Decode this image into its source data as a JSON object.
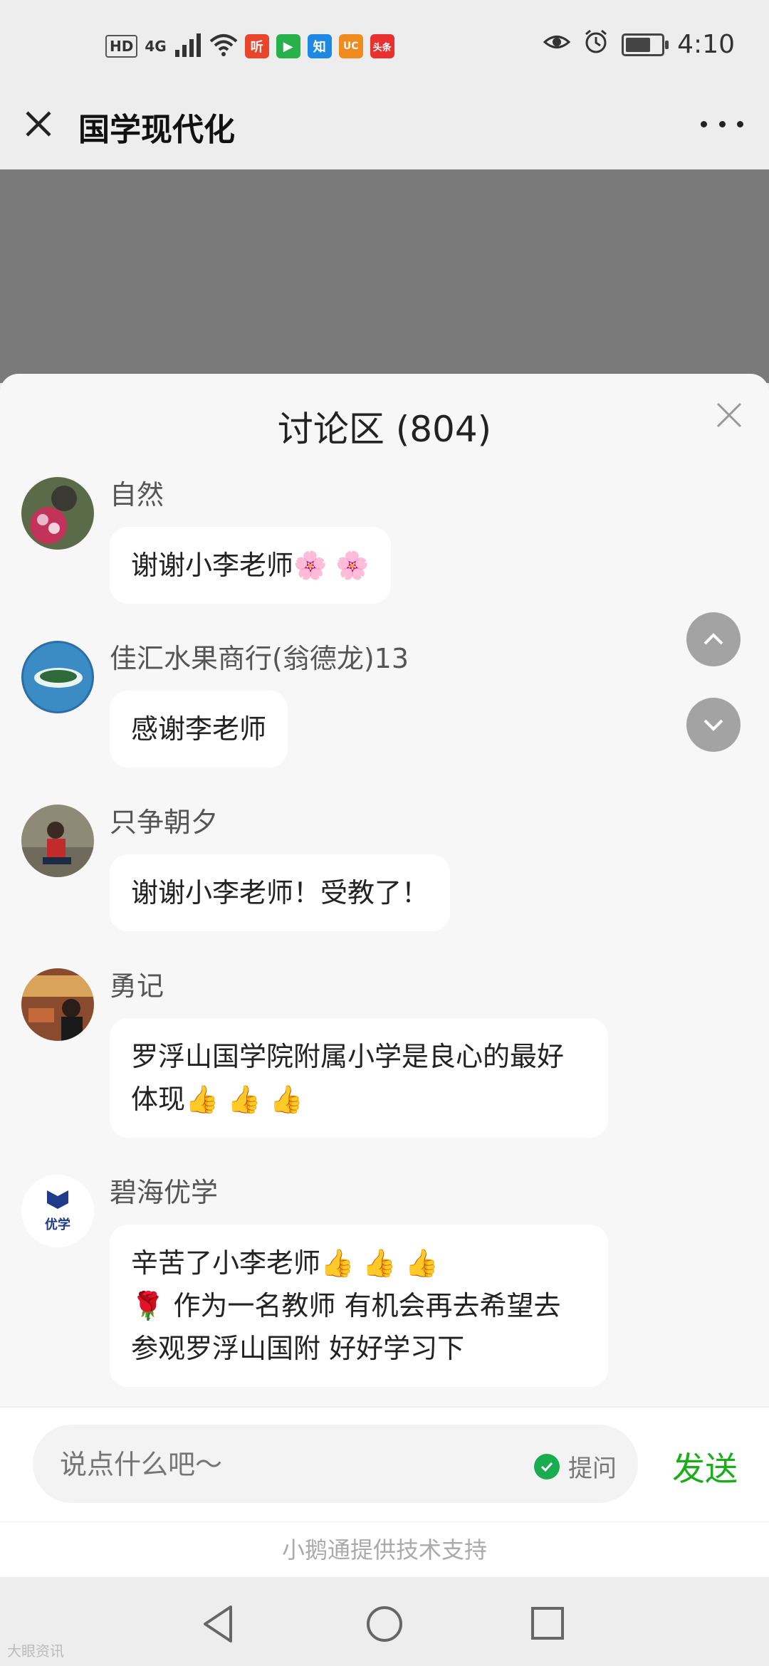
{
  "status_bar": {
    "network_badges": [
      "HD",
      "4G"
    ],
    "apps": [
      {
        "label": "听",
        "icon": "ting-app-icon",
        "color": "#e8452b"
      },
      {
        "label": "▶",
        "icon": "video-app-icon",
        "color": "#27b14a"
      },
      {
        "label": "知",
        "icon": "zhihu-app-icon",
        "color": "#1e88e5"
      },
      {
        "label": "UC",
        "icon": "uc-browser-icon",
        "color": "#f28b1e"
      },
      {
        "label": "头条",
        "icon": "toutiao-app-icon",
        "color": "#e8302f"
      }
    ],
    "battery_level": 0.7,
    "time": "4:10"
  },
  "header": {
    "title": "国学现代化"
  },
  "discussion": {
    "title": "讨论区 (804)",
    "messages": [
      {
        "user": "自然",
        "text": "谢谢小李老师🌸 🌸",
        "avatar_color": "#6b7a5a"
      },
      {
        "user": "佳汇水果商行(翁德龙)13",
        "text": "感谢李老师",
        "avatar_color": "#2f7fb5"
      },
      {
        "user": "只争朝夕",
        "text": "谢谢小李老师！受教了！",
        "avatar_color": "#8a8270"
      },
      {
        "user": "勇记",
        "text": "罗浮山国学院附属小学是良心的最好体现👍 👍 👍",
        "avatar_color": "#9a5a3a"
      },
      {
        "user": "碧海优学",
        "text": "辛苦了小李老师👍 👍 👍\n🌹 作为一名教师 有机会再去希望去参观罗浮山国附 好好学习下",
        "avatar_color": "#ffffff",
        "avatar_label": "优学"
      }
    ]
  },
  "input": {
    "placeholder": "说点什么吧～",
    "ask_label": "提问",
    "send_label": "发送"
  },
  "footer": {
    "support_text": "小鹅通提供技术支持",
    "watermark": "大眼资讯"
  },
  "colors": {
    "accent_green": "#1aad19",
    "dim_overlay": "#7a7a7a"
  }
}
